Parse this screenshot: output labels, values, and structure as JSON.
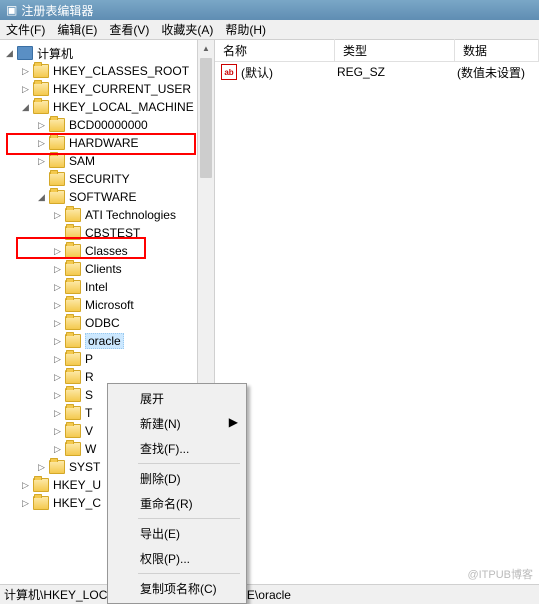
{
  "window": {
    "title": "注册表编辑器"
  },
  "menu": {
    "file": "文件(F)",
    "edit": "编辑(E)",
    "view": "查看(V)",
    "favorites": "收藏夹(A)",
    "help": "帮助(H)"
  },
  "tree": {
    "root": "计算机",
    "hkcr": "HKEY_CLASSES_ROOT",
    "hkcu": "HKEY_CURRENT_USER",
    "hklm": "HKEY_LOCAL_MACHINE",
    "bcd": "BCD00000000",
    "hardware": "HARDWARE",
    "sam": "SAM",
    "security": "SECURITY",
    "software": "SOFTWARE",
    "ati": "ATI Technologies",
    "cbstest": "CBSTEST",
    "classes": "Classes",
    "clients": "Clients",
    "intel": "Intel",
    "microsoft": "Microsoft",
    "odbc": "ODBC",
    "oracle": "oracle",
    "p": "P",
    "r": "R",
    "s": "S",
    "t": "T",
    "v": "V",
    "w": "W",
    "syst": "SYST",
    "hkey_u": "HKEY_U",
    "hkey_c": "HKEY_C"
  },
  "list": {
    "col_name": "名称",
    "col_type": "类型",
    "col_data": "数据",
    "row_name": "(默认)",
    "row_type": "REG_SZ",
    "row_data": "(数值未设置)"
  },
  "context": {
    "expand": "展开",
    "new": "新建(N)",
    "find": "查找(F)...",
    "delete": "删除(D)",
    "rename": "重命名(R)",
    "export": "导出(E)",
    "permissions": "权限(P)...",
    "copykey": "复制项名称(C)"
  },
  "statusbar": "计算机\\HKEY_LOCAL_MACHINE\\SOFTWARE\\oracle",
  "watermark": "@ITPUB博客"
}
